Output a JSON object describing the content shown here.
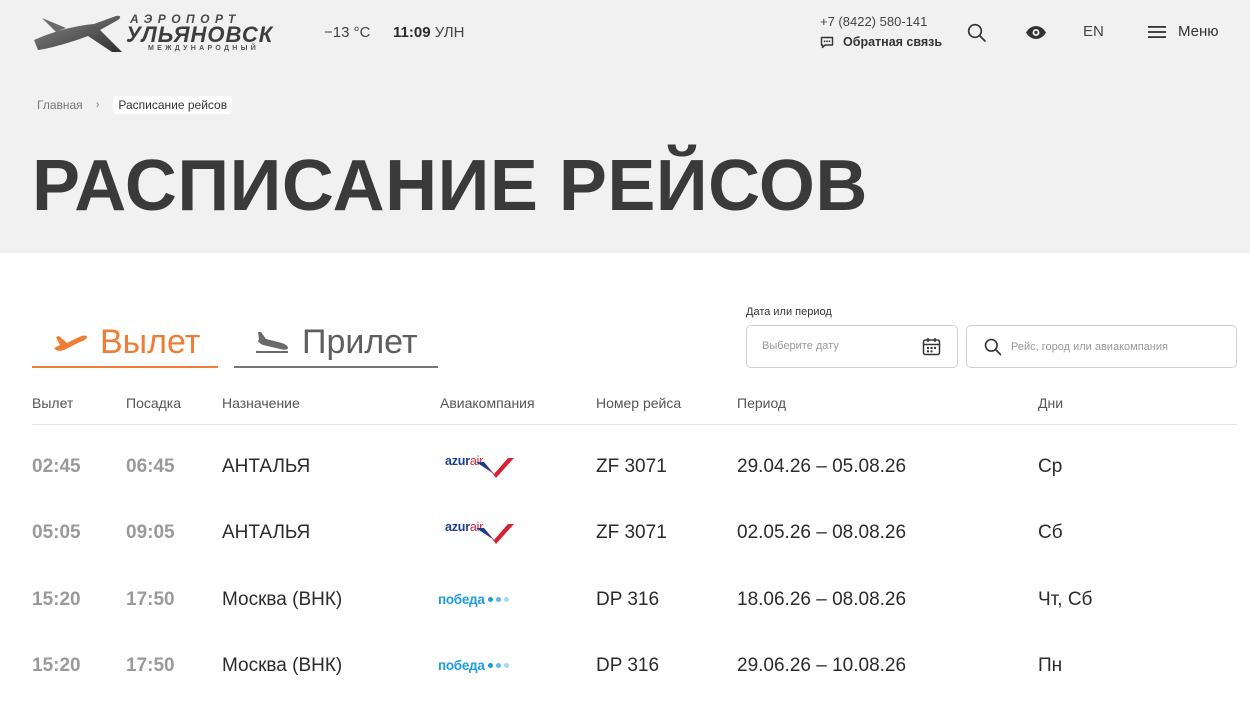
{
  "header": {
    "logo": {
      "top": "АЭРОПОРТ",
      "main": "УЛЬЯНОВСК",
      "sub": "МЕЖДУНАРОДНЫЙ"
    },
    "weather": "−13 °C",
    "time": "11:09",
    "timezone": "УЛН",
    "phone": "+7 (8422) 580-141",
    "feedback": "Обратная связь",
    "lang": "EN",
    "menu": "Меню"
  },
  "breadcrumb": {
    "home": "Главная",
    "current": "Расписание рейсов"
  },
  "page_title": "РАСПИСАНИЕ РЕЙСОВ",
  "tabs": {
    "departure": "Вылет",
    "arrival": "Прилет"
  },
  "filters": {
    "date_label": "Дата или период",
    "date_placeholder": "Выберите дату",
    "search_placeholder": "Рейс, город или авиакомпания"
  },
  "table": {
    "headers": [
      "Вылет",
      "Посадка",
      "Назначение",
      "Авиакомпания",
      "Номер рейса",
      "Период",
      "Дни"
    ],
    "rows": [
      {
        "dep": "02:45",
        "arr": "06:45",
        "dest": "АНТАЛЬЯ",
        "airline": "azur air",
        "flight": "ZF 3071",
        "period": "29.04.26  –  05.08.26",
        "days": "Ср"
      },
      {
        "dep": "05:05",
        "arr": "09:05",
        "dest": "АНТАЛЬЯ",
        "airline": "azur air",
        "flight": "ZF 3071",
        "period": "02.05.26  –  08.08.26",
        "days": "Сб"
      },
      {
        "dep": "15:20",
        "arr": "17:50",
        "dest": "Москва (ВНК)",
        "airline": "победа",
        "flight": "DP 316",
        "period": "18.06.26  –  08.08.26",
        "days": "Чт, Сб"
      },
      {
        "dep": "15:20",
        "arr": "17:50",
        "dest": "Москва (ВНК)",
        "airline": "победа",
        "flight": "DP 316",
        "period": "29.06.26  –  10.08.26",
        "days": "Пн"
      }
    ]
  },
  "airline_logos": {
    "azur": {
      "word1": "azur",
      "word2": "air"
    },
    "pobeda": {
      "word": "победа"
    }
  },
  "colors": {
    "accent": "#ee7d35",
    "hero_bg": "#f1f1f1",
    "azur_blue": "#1b3f8f",
    "azur_red": "#d62232",
    "pobeda_blue": "#1e9ce0"
  },
  "icons": [
    "plane-logo-icon",
    "chat-icon",
    "search-icon",
    "eye-icon",
    "hamburger-icon",
    "chevron-right-icon",
    "departure-plane-icon",
    "arrival-plane-icon",
    "calendar-icon"
  ]
}
